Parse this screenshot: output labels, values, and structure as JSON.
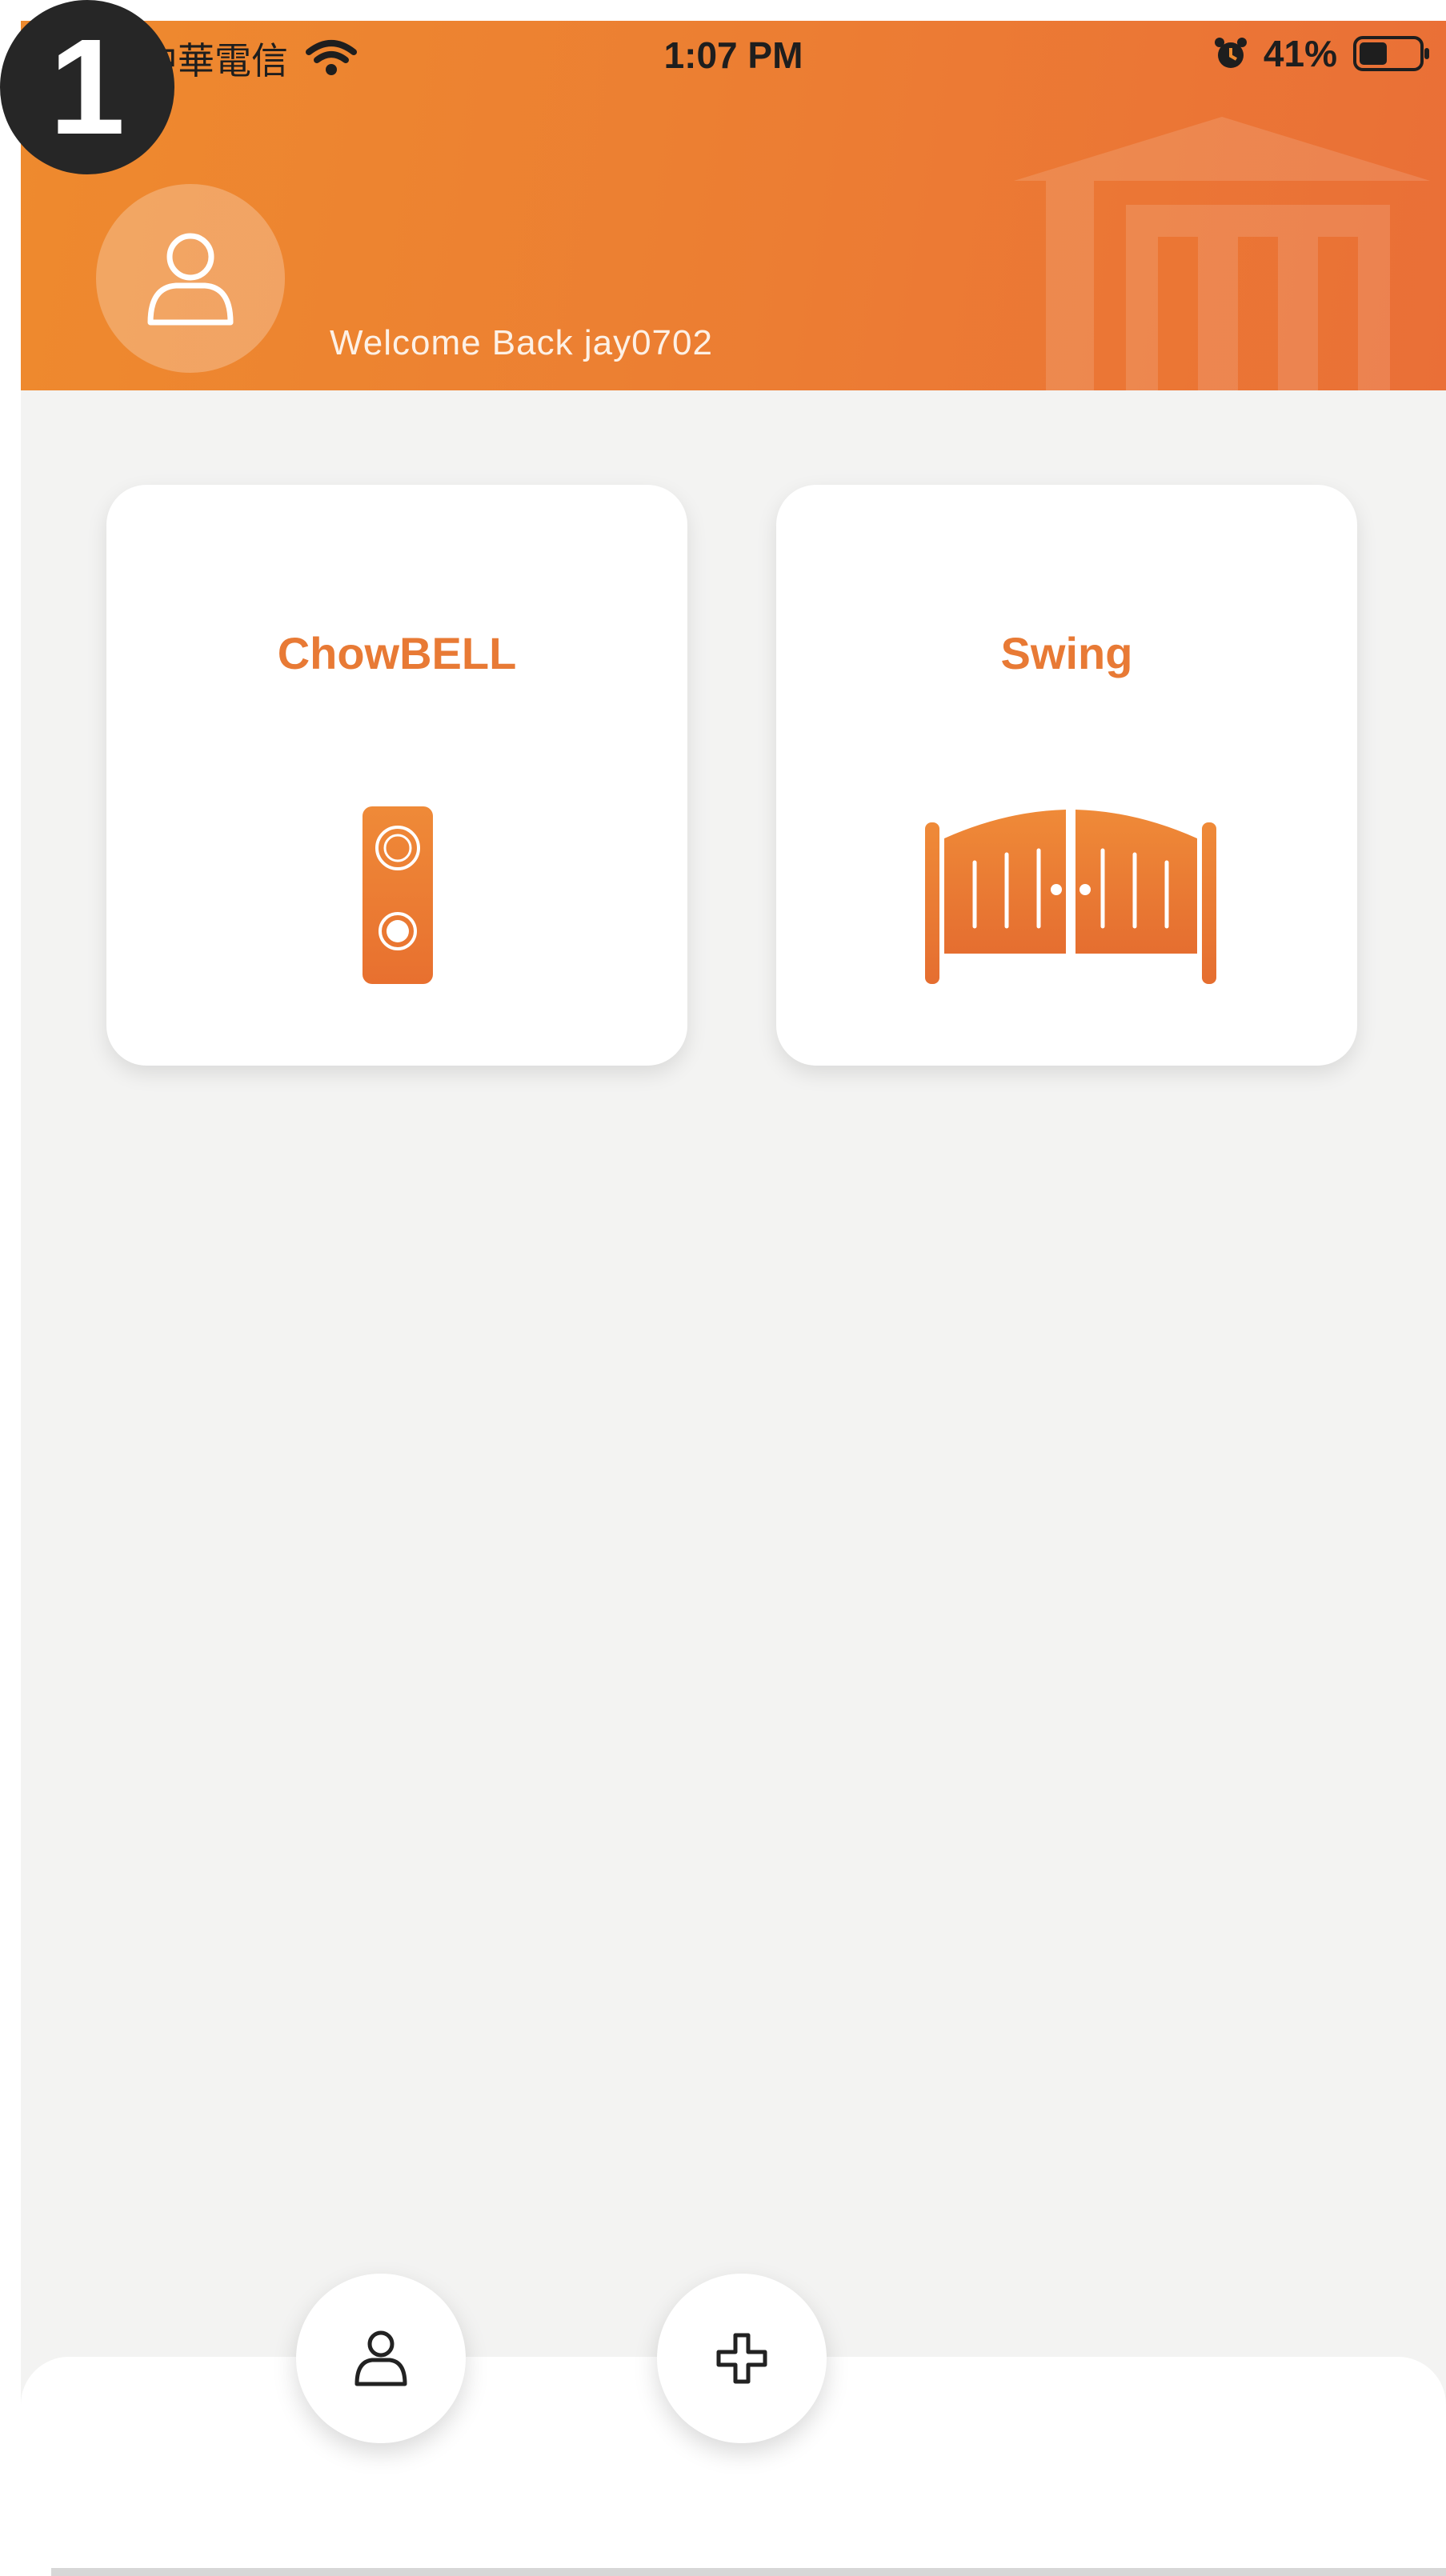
{
  "step_badge": "1",
  "status_bar": {
    "carrier": "中華電信",
    "time": "1:07 PM",
    "battery": "41%",
    "icons": [
      "wifi-icon",
      "alarm-icon",
      "battery-icon"
    ]
  },
  "header": {
    "welcome_text": "Welcome Back jay0702",
    "avatar_icon": "user-icon"
  },
  "devices": [
    {
      "label": "ChowBELL",
      "icon": "doorbell-icon"
    },
    {
      "label": "Swing",
      "icon": "swing-gate-icon"
    }
  ],
  "bottom_nav": {
    "profile_icon": "user-icon",
    "add_icon": "plus-icon"
  },
  "colors": {
    "accent": "#e87a35",
    "header_start": "#ee8a2e",
    "header_end": "#ea6f37",
    "background": "#f3f3f2",
    "card": "#ffffff"
  }
}
